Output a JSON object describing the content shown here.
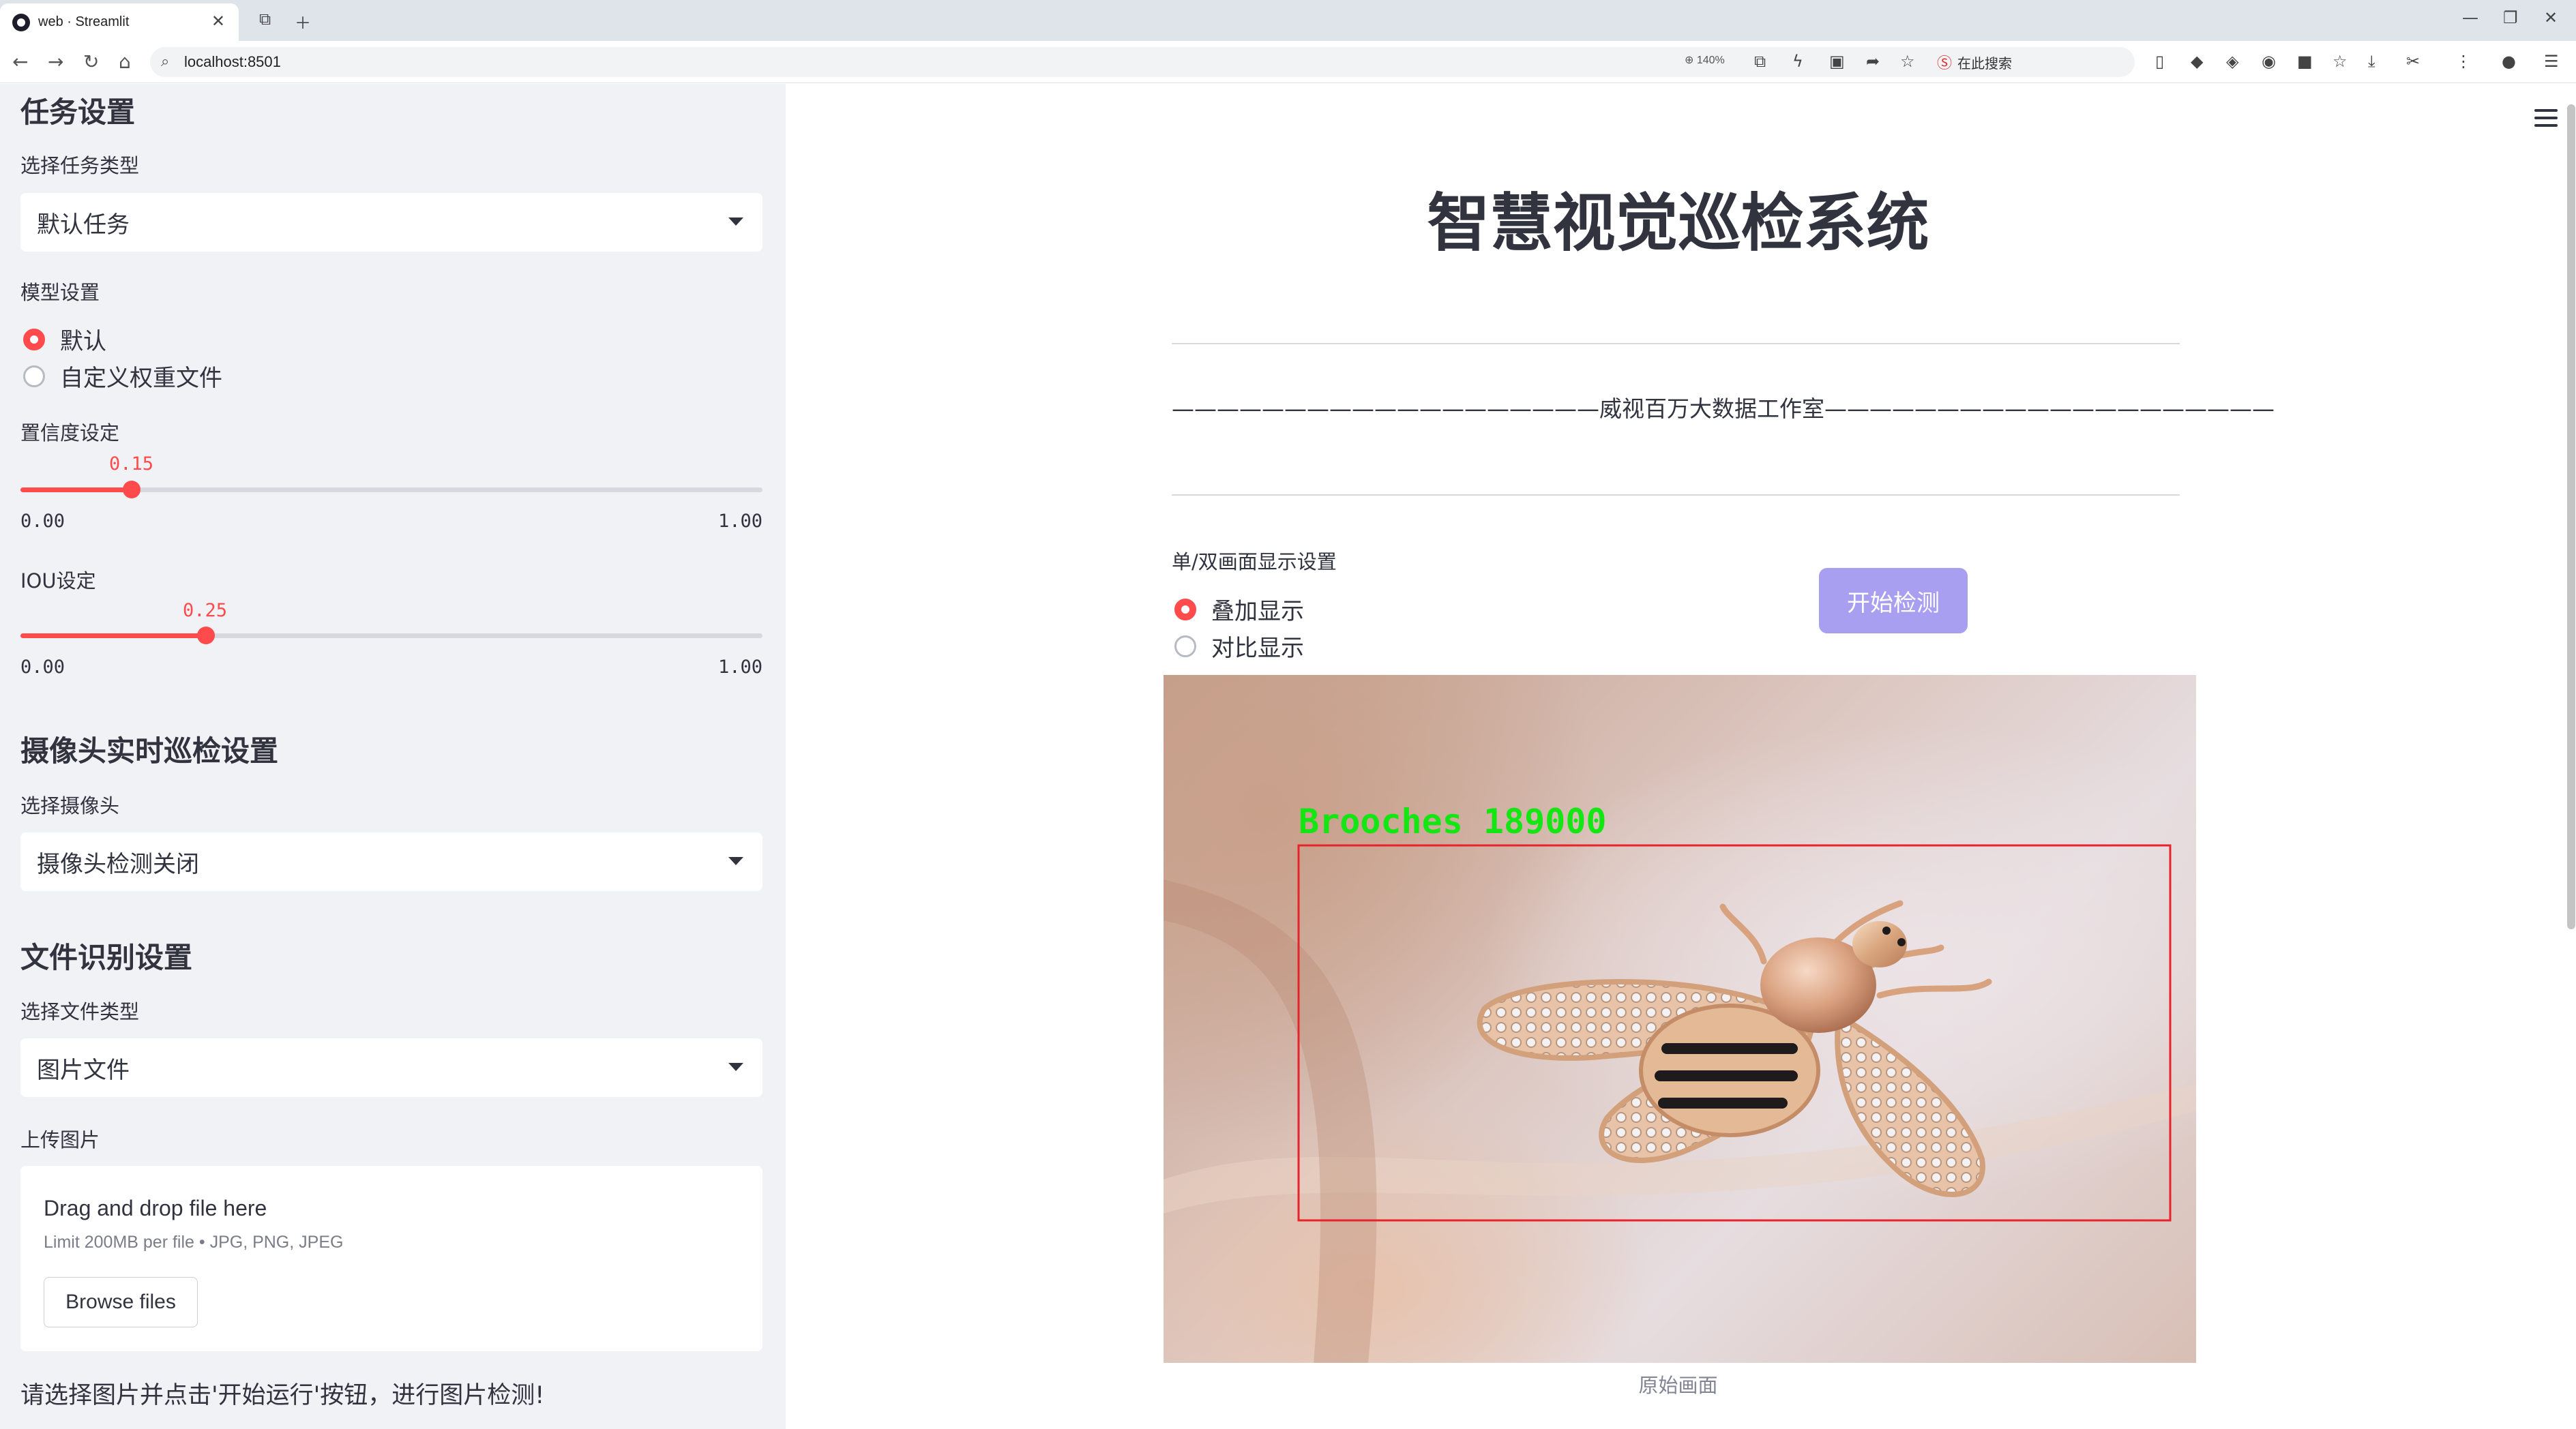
{
  "browser": {
    "tab_title": "web · Streamlit",
    "url": "localhost:8501",
    "zoom": "140%",
    "search_label": "在此搜索"
  },
  "sidebar": {
    "task_heading": "任务设置",
    "task_type_label": "选择任务类型",
    "task_type_value": "默认任务",
    "model_label": "模型设置",
    "model_options": [
      "默认",
      "自定义权重文件"
    ],
    "model_selected": 0,
    "conf_label": "置信度设定",
    "conf_value": "0.15",
    "conf_fraction": 0.15,
    "iou_label": "IOU设定",
    "iou_value": "0.25",
    "iou_fraction": 0.25,
    "slider_min": "0.00",
    "slider_max": "1.00",
    "camera_heading": "摄像头实时巡检设置",
    "camera_label": "选择摄像头",
    "camera_value": "摄像头检测关闭",
    "file_heading": "文件识别设置",
    "file_type_label": "选择文件类型",
    "file_type_value": "图片文件",
    "upload_label": "上传图片",
    "upload_drop_text": "Drag and drop file here",
    "upload_limit_text": "Limit 200MB per file • JPG, PNG, JPEG",
    "browse_button": "Browse files",
    "note": "请选择图片并点击'开始运行'按钮，进行图片检测!"
  },
  "main": {
    "title": "智慧视觉巡检系统",
    "studio_line": "———————————————————威视百万大数据工作室————————————————————",
    "display_label": "单/双画面显示设置",
    "display_options": [
      "叠加显示",
      "对比显示"
    ],
    "display_selected": 0,
    "start_button": "开始检测",
    "detection_label": "Brooches  189000",
    "image_caption": "原始画面"
  },
  "colors": {
    "accent": "#ff4b4b",
    "start_button": "#a99ff0",
    "detection_box": "#e8232c",
    "detection_text": "#14e614"
  }
}
